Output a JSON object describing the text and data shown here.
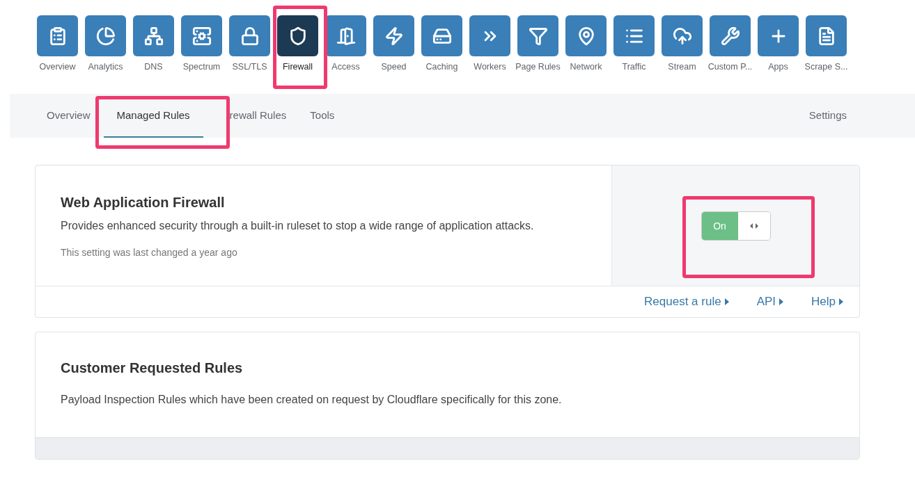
{
  "products": [
    {
      "label": "Overview",
      "selected": false
    },
    {
      "label": "Analytics",
      "selected": false
    },
    {
      "label": "DNS",
      "selected": false
    },
    {
      "label": "Spectrum",
      "selected": false
    },
    {
      "label": "SSL/TLS",
      "selected": false
    },
    {
      "label": "Firewall",
      "selected": true
    },
    {
      "label": "Access",
      "selected": false
    },
    {
      "label": "Speed",
      "selected": false
    },
    {
      "label": "Caching",
      "selected": false
    },
    {
      "label": "Workers",
      "selected": false
    },
    {
      "label": "Page Rules",
      "selected": false
    },
    {
      "label": "Network",
      "selected": false
    },
    {
      "label": "Traffic",
      "selected": false
    },
    {
      "label": "Stream",
      "selected": false
    },
    {
      "label": "Custom P...",
      "selected": false
    },
    {
      "label": "Apps",
      "selected": false
    },
    {
      "label": "Scrape S...",
      "selected": false
    }
  ],
  "tabs": [
    {
      "label": "Overview",
      "selected": false
    },
    {
      "label": "Managed Rules",
      "selected": true
    },
    {
      "label": "rewall Rules",
      "selected": false
    },
    {
      "label": "Tools",
      "selected": false
    }
  ],
  "settings_tab": {
    "label": "Settings",
    "selected": false
  },
  "waf_card": {
    "title": "Web Application Firewall",
    "description": "Provides enhanced security through a built-in ruleset to stop a wide range of application attacks.",
    "note": "This setting was last changed a year ago",
    "toggle": {
      "label": "On",
      "on": true
    },
    "links": [
      "Request a rule",
      "API",
      "Help"
    ]
  },
  "customer_card": {
    "title": "Customer Requested Rules",
    "description": "Payload Inspection Rules which have been created on request by Cloudflare specifically for this zone."
  }
}
